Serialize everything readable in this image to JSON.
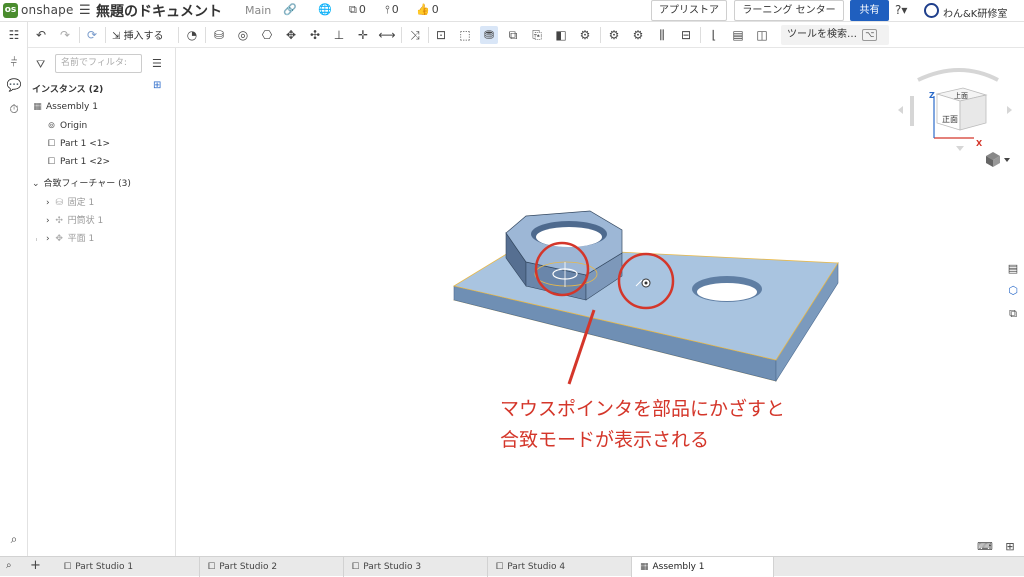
{
  "topbar": {
    "logo_letter": "os",
    "brand": "onshape",
    "hamburger": "☰",
    "doc_title": "無題のドキュメント",
    "branch": "Main",
    "link_icon": "🔗",
    "globe_icon": "🌐",
    "copies_count": "0",
    "versions_count": "0",
    "likes_count": "0",
    "app_store": "アプリストア",
    "learning_center": "ラーニング センター",
    "share": "共有",
    "help": "?▾",
    "user": "わん&K研修室"
  },
  "rail": [
    "feature-tree-icon",
    "variables-icon",
    "comment-icon",
    "timer-icon",
    "search-bottom-icon"
  ],
  "toolbar": {
    "insert": "挿入する",
    "search_label": "ツールを検索…",
    "search_kbd1": "⌥",
    "search_kbd2": "C"
  },
  "panel": {
    "filter_placeholder": "名前でフィルタ:",
    "instances_header": "インスタンス (2)",
    "assembly": "Assembly 1",
    "origin": "Origin",
    "part1": "Part 1 <1>",
    "part2": "Part 1 <2>",
    "mates_header": "合致フィーチャー (3)",
    "mate1": "固定 1",
    "mate2": "円筒状 1",
    "mate3": "平面 1"
  },
  "viewcube": {
    "top_label": "上面",
    "front_label": "正面",
    "axis_z": "Z",
    "axis_x": "X"
  },
  "annotation": {
    "line1": "マウスポインタを部品にかざすと",
    "line2": "合致モードが表示される",
    "color": "#d4362a"
  },
  "tabs": [
    {
      "label": "Part Studio 1",
      "active": false
    },
    {
      "label": "Part Studio 2",
      "active": false
    },
    {
      "label": "Part Studio 3",
      "active": false
    },
    {
      "label": "Part Studio 4",
      "active": false
    },
    {
      "label": "Assembly 1",
      "active": true
    }
  ],
  "colors": {
    "part_face": "#a9c4e0",
    "part_side": "#6f8fb4",
    "share_button": "#1f5fbf",
    "selection_edge": "#e8b94a"
  }
}
